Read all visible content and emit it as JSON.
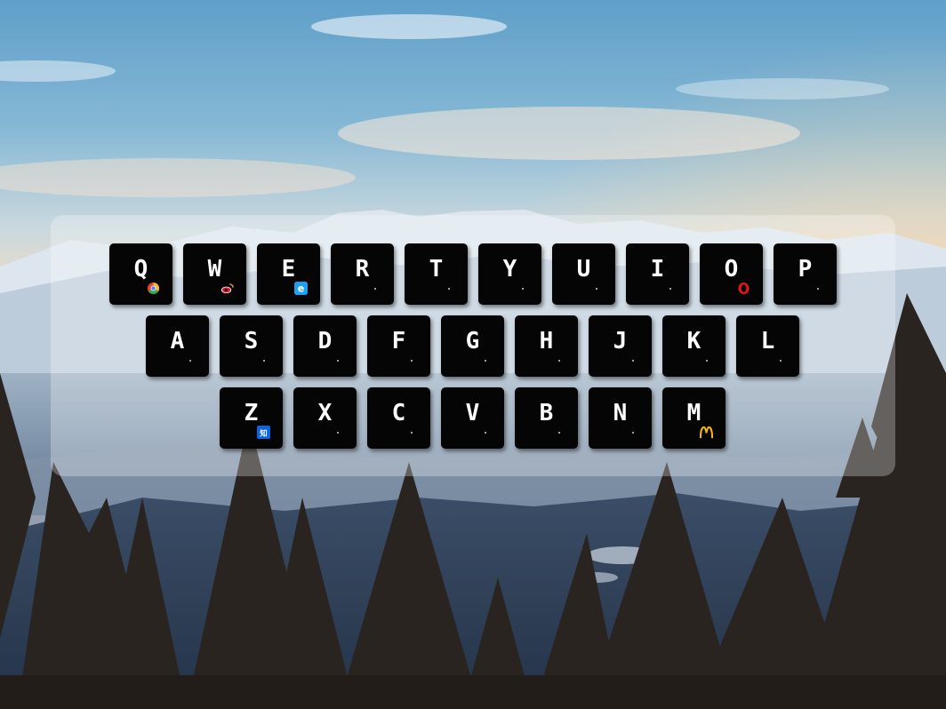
{
  "keyboard": {
    "rows": [
      [
        "Q",
        "W",
        "E",
        "R",
        "T",
        "Y",
        "U",
        "I",
        "O",
        "P"
      ],
      [
        "A",
        "S",
        "D",
        "F",
        "G",
        "H",
        "J",
        "K",
        "L"
      ],
      [
        "Z",
        "X",
        "C",
        "V",
        "B",
        "N",
        "M"
      ]
    ],
    "shortcut_icons": {
      "Q": "browser-ball-icon",
      "W": "weibo-icon",
      "E": "ie-browser-icon",
      "O": "opera-icon",
      "Z": "zhihu-icon",
      "M": "mcdonalds-icon"
    }
  },
  "colors": {
    "key_bg": "#050505",
    "key_text": "#ffffff",
    "panel_tint": "rgba(255,255,255,0.28)"
  }
}
